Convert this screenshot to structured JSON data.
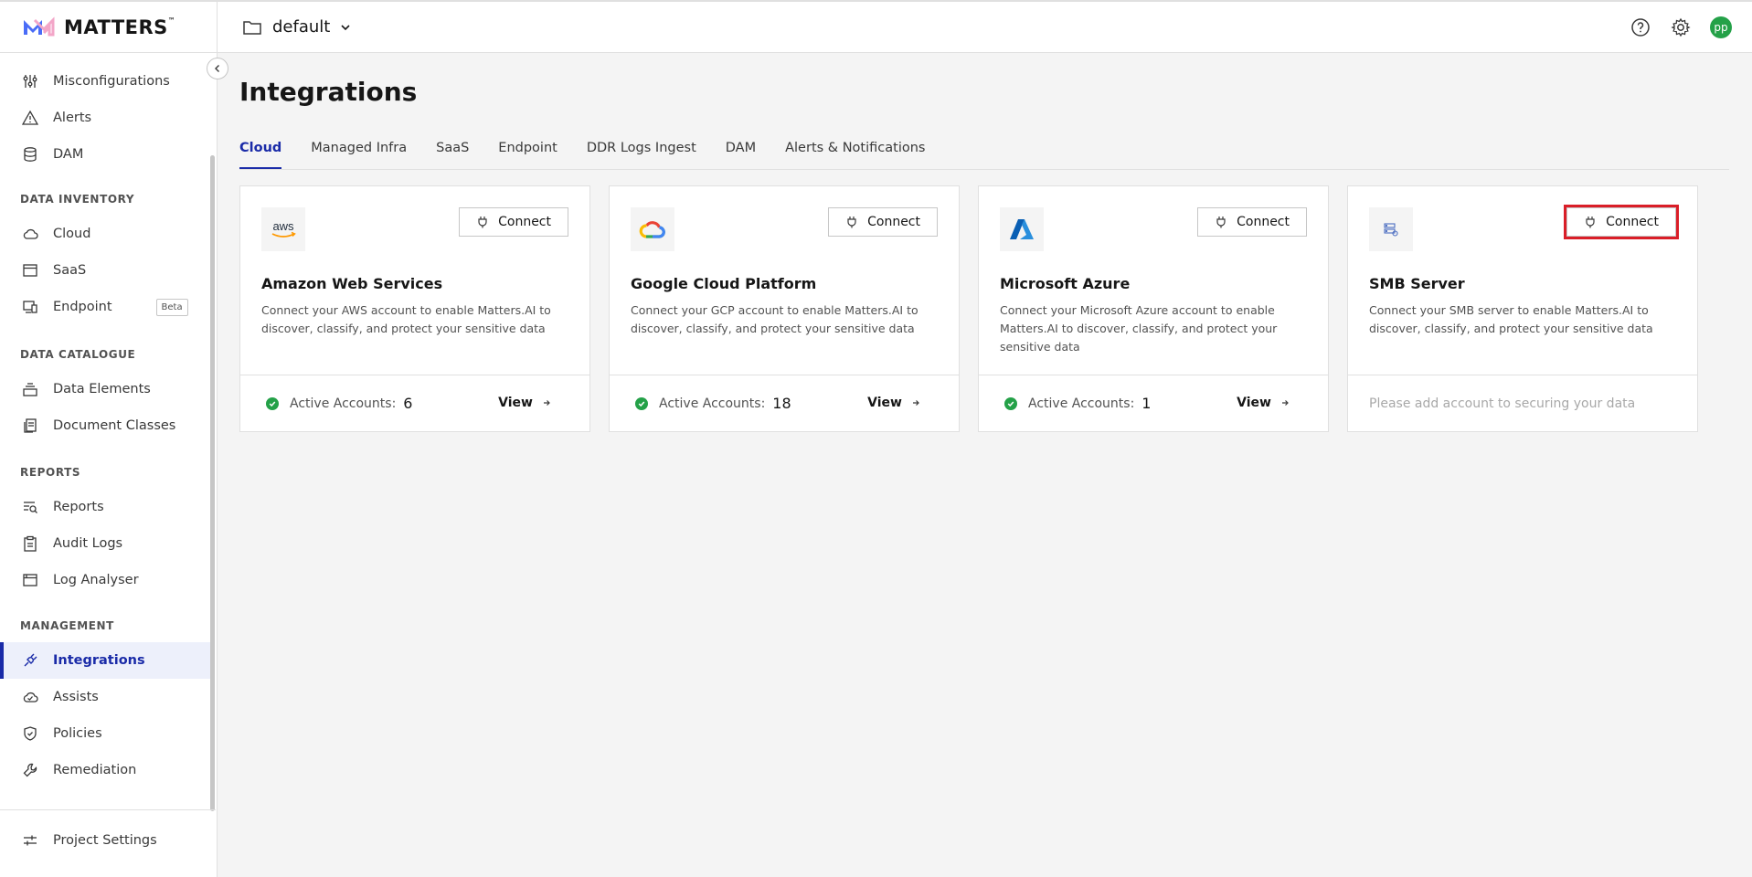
{
  "app": {
    "brand": "MATTERS",
    "trademark": "™",
    "project": "default"
  },
  "sidebar": {
    "top_items": [
      {
        "label": "Misconfigurations",
        "icon": "sliders-icon"
      },
      {
        "label": "Alerts",
        "icon": "warning-icon"
      },
      {
        "label": "DAM",
        "icon": "database-icon"
      }
    ],
    "sections": [
      {
        "title": "DATA INVENTORY",
        "items": [
          {
            "label": "Cloud",
            "icon": "cloud-icon"
          },
          {
            "label": "SaaS",
            "icon": "window-icon"
          },
          {
            "label": "Endpoint",
            "icon": "devices-icon",
            "badge": "Beta"
          }
        ]
      },
      {
        "title": "DATA CATALOGUE",
        "items": [
          {
            "label": "Data Elements",
            "icon": "stack-icon"
          },
          {
            "label": "Document Classes",
            "icon": "documents-icon"
          }
        ]
      },
      {
        "title": "REPORTS",
        "items": [
          {
            "label": "Reports",
            "icon": "report-search-icon"
          },
          {
            "label": "Audit Logs",
            "icon": "clipboard-icon"
          },
          {
            "label": "Log Analyser",
            "icon": "browser-icon"
          }
        ]
      },
      {
        "title": "MANAGEMENT",
        "items": [
          {
            "label": "Integrations",
            "icon": "plug-icon",
            "active": true
          },
          {
            "label": "Assists",
            "icon": "cloud-check-icon"
          },
          {
            "label": "Policies",
            "icon": "shield-check-icon"
          },
          {
            "label": "Remediation",
            "icon": "wrench-icon"
          }
        ]
      }
    ],
    "bottom_item": {
      "label": "Project Settings",
      "icon": "settings-adjust-icon"
    }
  },
  "main": {
    "title": "Integrations",
    "tabs": [
      "Cloud",
      "Managed Infra",
      "SaaS",
      "Endpoint",
      "DDR Logs Ingest",
      "DAM",
      "Alerts & Notifications"
    ],
    "active_tab": "Cloud",
    "cards": [
      {
        "title": "Amazon Web Services",
        "logo_text": "aws",
        "description": "Connect your AWS account to enable Matters.AI to discover, classify, and protect your sensitive data",
        "connect_label": "Connect",
        "accounts_label": "Active Accounts:",
        "accounts": "6",
        "view_label": "View"
      },
      {
        "title": "Google Cloud Platform",
        "description": "Connect your GCP account to enable Matters.AI to discover, classify, and protect your sensitive data",
        "connect_label": "Connect",
        "accounts_label": "Active Accounts:",
        "accounts": "18",
        "view_label": "View"
      },
      {
        "title": "Microsoft Azure",
        "description": "Connect your Microsoft Azure account to enable Matters.AI to discover, classify, and protect your sensitive data",
        "connect_label": "Connect",
        "accounts_label": "Active Accounts:",
        "accounts": "1",
        "view_label": "View"
      },
      {
        "title": "SMB Server",
        "description": "Connect your SMB server to enable Matters.AI to discover, classify, and protect your sensitive data",
        "connect_label": "Connect",
        "empty_message": "Please add account to securing your data"
      }
    ]
  },
  "header": {
    "avatar_initials": "pp"
  },
  "colors": {
    "accent": "#1a2ba8",
    "success": "#24a148",
    "highlight": "#da1e28"
  }
}
